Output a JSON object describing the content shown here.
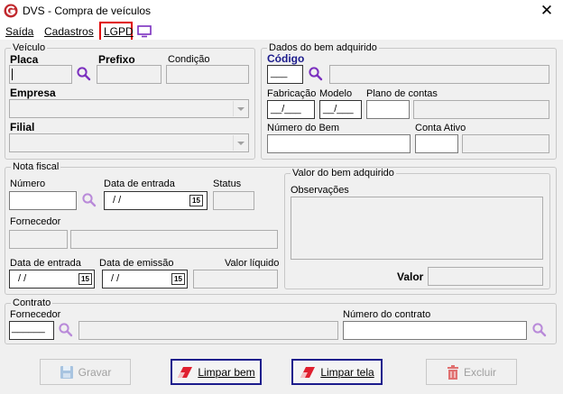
{
  "window": {
    "title": "DVS - Compra de veículos"
  },
  "menu": {
    "saida": "Saída",
    "cadastros": "Cadastros",
    "lgpd": "LGPD"
  },
  "veiculo": {
    "legend": "Veículo",
    "placa": "Placa",
    "prefixo": "Prefixo",
    "condicao": "Condição",
    "empresa": "Empresa",
    "filial": "Filial"
  },
  "bem": {
    "legend": "Dados do bem adquirido",
    "codigo": "Código",
    "codigo_mask": "___",
    "fabricacao": "Fabricação",
    "modelo": "Modelo",
    "plano": "Plano de contas",
    "year_mask": "__/___",
    "numero_bem": "Número do Bem",
    "conta_ativo": "Conta Ativo"
  },
  "nota": {
    "legend": "Nota fiscal",
    "numero": "Número",
    "data_entrada": "Data de entrada",
    "status": "Status",
    "fornecedor": "Fornecedor",
    "data_entrada2": "Data de entrada",
    "data_emissao": "Data de emissão",
    "valor_liquido": "Valor líquido",
    "date_mask": "/ /",
    "date_mask2": "/ /",
    "date_mask3": "/ /",
    "cal_day": "15"
  },
  "valor_bem": {
    "legend": "Valor do bem adquirido",
    "observacoes": "Observações",
    "valor": "Valor"
  },
  "contrato": {
    "legend": "Contrato",
    "fornecedor": "Fornecedor",
    "fornecedor_mask": "______",
    "numero": "Número do contrato"
  },
  "buttons": {
    "gravar": "Gravar",
    "limpar_bem": "Limpar bem",
    "limpar_tela": "Limpar tela",
    "excluir": "Excluir"
  },
  "colors": {
    "accent_purple": "#7b2fbf",
    "brand_red": "#c0282d",
    "highlight_red": "#e00000"
  }
}
